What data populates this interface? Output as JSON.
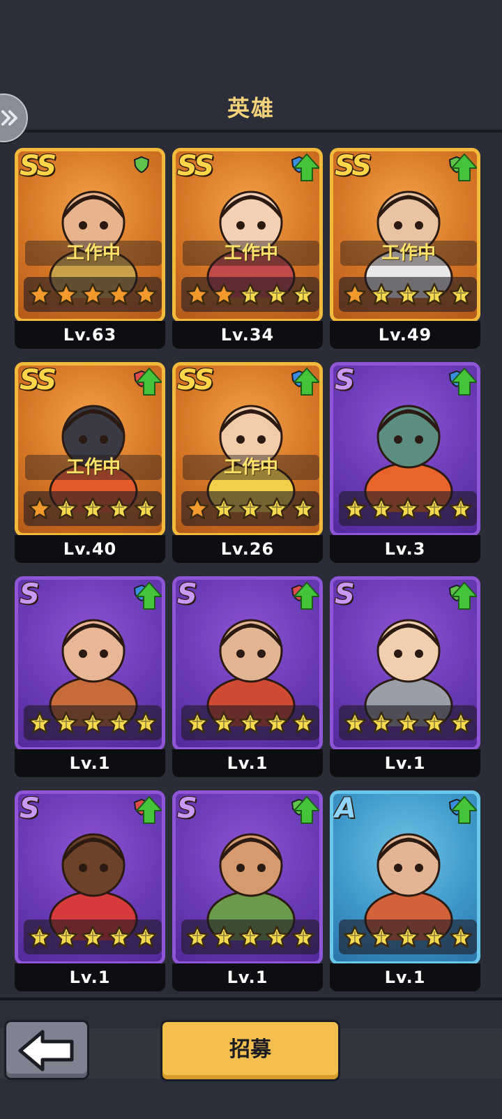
{
  "header": {
    "title": "英雄"
  },
  "heroes": [
    {
      "rank": "SS",
      "status": "工作中",
      "stars_filled": 5,
      "level": "Lv.63",
      "upgrade": false,
      "class_icon": "sword-icon",
      "art": "zeus"
    },
    {
      "rank": "SS",
      "status": "工作中",
      "stars_filled": 2,
      "level": "Lv.34",
      "upgrade": true,
      "class_icon": "shield-icon",
      "art": "valkyrie"
    },
    {
      "rank": "SS",
      "status": "工作中",
      "stars_filled": 1,
      "level": "Lv.49",
      "upgrade": true,
      "class_icon": "sword-icon",
      "art": "wizard"
    },
    {
      "rank": "SS",
      "status": "工作中",
      "stars_filled": 1,
      "level": "Lv.40",
      "upgrade": true,
      "class_icon": "cross-icon",
      "art": "dark-lord"
    },
    {
      "rank": "SS",
      "status": "工作中",
      "stars_filled": 1,
      "level": "Lv.26",
      "upgrade": true,
      "class_icon": "shield-icon",
      "art": "knight"
    },
    {
      "rank": "S",
      "status": "",
      "stars_filled": 0,
      "level": "Lv.3",
      "upgrade": true,
      "class_icon": "shield-icon",
      "art": "robot"
    },
    {
      "rank": "S",
      "status": "",
      "stars_filled": 0,
      "level": "Lv.1",
      "upgrade": true,
      "class_icon": "shield-icon",
      "art": "gunner"
    },
    {
      "rank": "S",
      "status": "",
      "stars_filled": 0,
      "level": "Lv.1",
      "upgrade": true,
      "class_icon": "cross-icon",
      "art": "viking"
    },
    {
      "rank": "S",
      "status": "",
      "stars_filled": 0,
      "level": "Lv.1",
      "upgrade": true,
      "class_icon": "sword-icon",
      "art": "scientist"
    },
    {
      "rank": "S",
      "status": "",
      "stars_filled": 0,
      "level": "Lv.1",
      "upgrade": true,
      "class_icon": "cross-icon",
      "art": "boxer"
    },
    {
      "rank": "S",
      "status": "",
      "stars_filled": 0,
      "level": "Lv.1",
      "upgrade": true,
      "class_icon": "sword-icon",
      "art": "archer"
    },
    {
      "rank": "A",
      "status": "",
      "stars_filled": 0,
      "level": "Lv.1",
      "upgrade": true,
      "class_icon": "shield-icon",
      "art": "dwarf"
    }
  ],
  "footer": {
    "back_icon": "arrow-left-icon",
    "recruit_label": "招募"
  },
  "colors": {
    "title": "#f3d27a",
    "star_filled": "#f29a2e",
    "star_empty": "#f5d94f",
    "upgrade_arrow": "#43c43a",
    "recruit_button": "#f5bf4f"
  }
}
